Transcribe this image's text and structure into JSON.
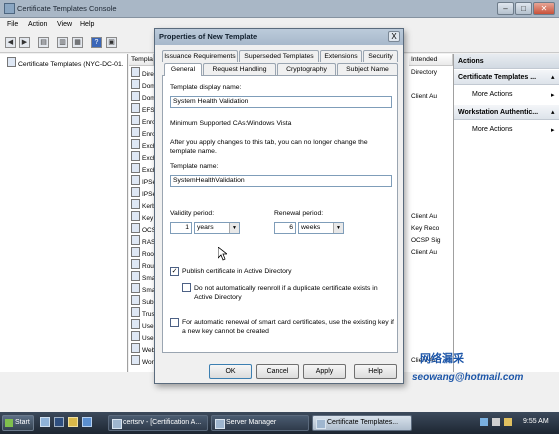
{
  "window": {
    "title": "Certificate Templates Console",
    "menu": [
      "File",
      "Action",
      "View",
      "Help"
    ]
  },
  "left_pane": {
    "tree_item": "Certificate Templates (NYC-DC-01."
  },
  "mid_pane": {
    "col_template": "Templa",
    "col_intended": "Intended",
    "rows": [
      "Dire",
      "Dom",
      "Dom",
      "EFS",
      "Enro",
      "Enro",
      "Exch",
      "Exch",
      "Exch",
      "IPSe",
      "IPSe",
      "Kerb",
      "Key",
      "OCS",
      "RAS",
      "Roo",
      "Rou",
      "Sma",
      "Sma",
      "Sub",
      "Trus",
      "Use",
      "Use",
      "Web",
      "Wor"
    ],
    "intended": [
      "Directory",
      "",
      "Client Au",
      "",
      "",
      "",
      "",
      "",
      "",
      "",
      "",
      "",
      "Client Au",
      "Key Reco",
      "OCSP Sig",
      "Client Au",
      "",
      "",
      "",
      "",
      "",
      "",
      "",
      "",
      "Client Au"
    ]
  },
  "actions": {
    "title": "Actions",
    "sections": [
      {
        "header": "Certificate Templates ...",
        "item": "More Actions"
      },
      {
        "header": "Workstation Authentic...",
        "item": "More Actions"
      }
    ]
  },
  "dialog": {
    "title": "Properties of New Template",
    "close": "X",
    "tabs_back": [
      "Issuance Requirements",
      "Superseded Templates",
      "Extensions",
      "Security"
    ],
    "tabs_front": [
      "General",
      "Request Handling",
      "Cryptography",
      "Subject Name"
    ],
    "display_name_label": "Template display name:",
    "display_name_value": "System Health Validation",
    "min_ca_label": "Minimum Supported CAs:",
    "min_ca_value": "Windows Vista",
    "info_text": "After you apply changes to this tab, you can no longer change the template name.",
    "template_name_label": "Template name:",
    "template_name_value": "SystemHealthValidation",
    "validity_label": "Validity period:",
    "validity_value": "1",
    "validity_unit": "years",
    "renewal_label": "Renewal period:",
    "renewal_value": "6",
    "renewal_unit": "weeks",
    "publish_label": "Publish certificate in Active Directory",
    "publish_checked": true,
    "reenroll_label": "Do not automatically reenroll if a duplicate certificate exists in Active Directory",
    "reenroll_checked": false,
    "smartcard_label": "For automatic renewal of smart card certificates, use the existing key if a new key cannot be created",
    "smartcard_checked": false,
    "buttons": {
      "ok": "OK",
      "cancel": "Cancel",
      "apply": "Apply",
      "help": "Help"
    }
  },
  "taskbar": {
    "start": "Start",
    "tasks": [
      "certsrv - [Certification A...",
      "Server Manager",
      "Certificate Templates..."
    ],
    "clock": "9:55 AM"
  },
  "watermark": {
    "line1": "网络漏采",
    "line2": "seowang@hotmail.com"
  },
  "colors": {
    "title_bar": "#a9b7c6",
    "dialog_border": "#5a6b7d",
    "watermark": "#1d56a8",
    "taskbar": "#2a3542"
  }
}
